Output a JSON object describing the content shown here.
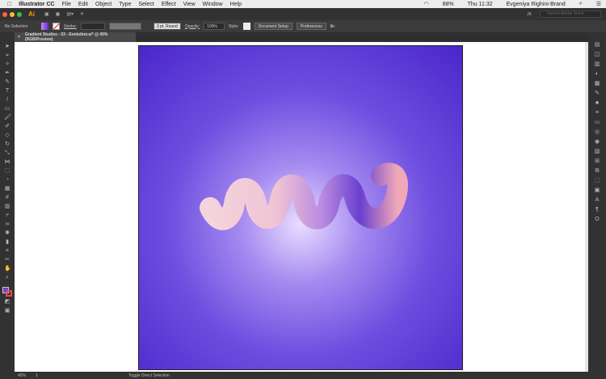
{
  "menubar": {
    "app": "Illustrator CC",
    "items": [
      "File",
      "Edit",
      "Object",
      "Type",
      "Select",
      "Effect",
      "View",
      "Window",
      "Help"
    ],
    "battery": "88%",
    "clock": "Thu 11:32",
    "user": "Evgeniya Righini-Brand"
  },
  "appbar": {
    "logo": "Ai",
    "workspace_user": "JK",
    "search_placeholder": "Search Adobe Stock"
  },
  "control": {
    "selection": "No Selection",
    "stroke_label": "Stroke:",
    "brush": "3 pt. Round",
    "opacity_label": "Opacity:",
    "opacity": "100%",
    "style_label": "Style:",
    "document_setup": "Document Setup",
    "preferences": "Preferences"
  },
  "tab": {
    "title": "Gradient Studies - 03 - Evolution.ai* @ 45% (RGB/Preview)"
  },
  "status": {
    "zoom": "45%",
    "artboard": "1",
    "tool": "Toggle Direct Selection"
  },
  "colors": {
    "fill": "#6a3fd8",
    "artboard_edge": "#4a26c9",
    "artboard_center": "#e8ddff"
  }
}
